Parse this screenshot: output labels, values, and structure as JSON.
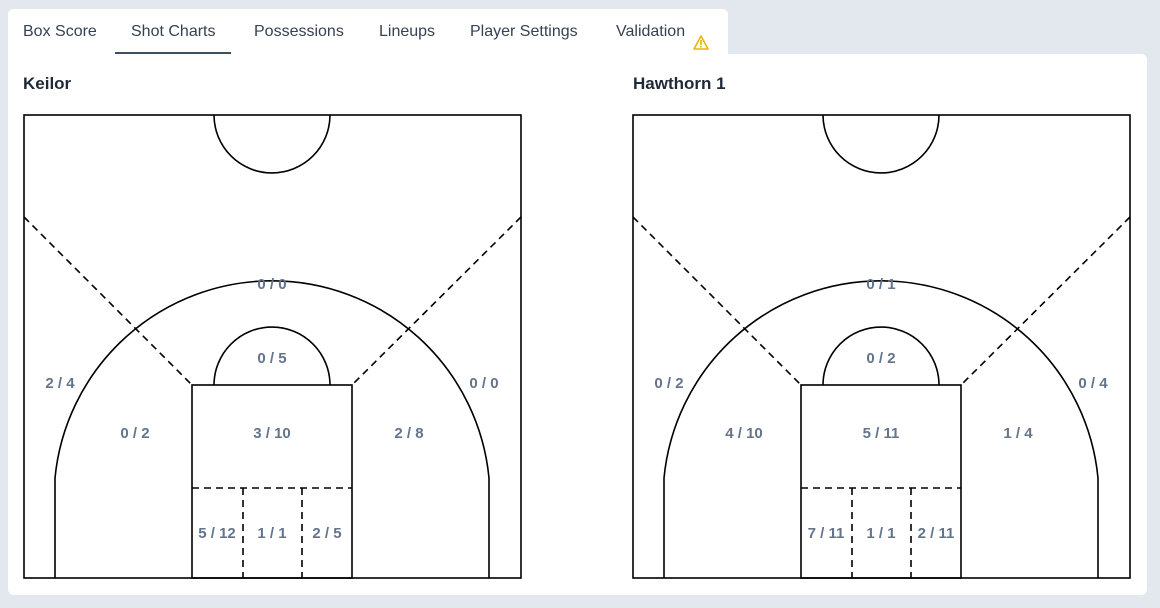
{
  "tabs": [
    {
      "label": "Box Score"
    },
    {
      "label": "Shot Charts"
    },
    {
      "label": "Possessions"
    },
    {
      "label": "Lineups"
    },
    {
      "label": "Player Settings"
    },
    {
      "label": "Validation"
    }
  ],
  "active_tab": "Shot Charts",
  "colors": {
    "warning": "#f0b400",
    "label": "#64748b",
    "line": "#000000"
  },
  "teams": [
    {
      "name": "Keilor",
      "zones": {
        "top_three": "0 / 0",
        "left_corner_three": "2 / 4",
        "right_corner_three": "0 / 0",
        "left_mid": "0 / 2",
        "right_mid": "2 / 8",
        "free_throw_circle": "0 / 5",
        "paint": "3 / 10",
        "restricted_left": "5 / 12",
        "restricted_center": "1 / 1",
        "restricted_right": "2 / 5"
      }
    },
    {
      "name": "Hawthorn 1",
      "zones": {
        "top_three": "0 / 1",
        "left_corner_three": "0 / 2",
        "right_corner_three": "0 / 4",
        "left_mid": "4 / 10",
        "right_mid": "1 / 4",
        "free_throw_circle": "0 / 2",
        "paint": "5 / 11",
        "restricted_left": "7 / 11",
        "restricted_center": "1 / 1",
        "restricted_right": "2 / 11"
      }
    }
  ]
}
